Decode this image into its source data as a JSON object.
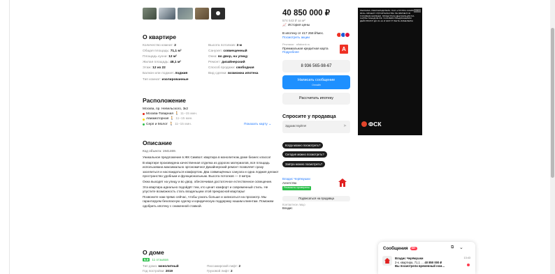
{
  "about": {
    "title": "О квартире",
    "left": [
      {
        "k": "Количество комнат:",
        "v": "2"
      },
      {
        "k": "Общая площадь:",
        "v": "71,1 м²"
      },
      {
        "k": "Площадь кухни:",
        "v": "12 м²"
      },
      {
        "k": "Жилая площадь:",
        "v": "48,1 м²"
      },
      {
        "k": "Этаж:",
        "v": "12 из 22"
      },
      {
        "k": "Балкон или лоджия:",
        "v": "лоджия"
      },
      {
        "k": "Тип комнат:",
        "v": "изолированные"
      }
    ],
    "right": [
      {
        "k": "Высота потолков:",
        "v": "3 м"
      },
      {
        "k": "Санузел:",
        "v": "совмещенный"
      },
      {
        "k": "Окна:",
        "v": "во двор, на улицу"
      },
      {
        "k": "Ремонт:",
        "v": "дизайнерский"
      },
      {
        "k": "Способ продажи:",
        "v": "свободная"
      },
      {
        "k": "Вид сделки:",
        "v": "возможна ипотека"
      }
    ]
  },
  "location": {
    "title": "Расположение",
    "address": "Москва, пр. Невельского, 3к2",
    "metro": [
      {
        "name": "Москва-Товарная",
        "time": "11–15 мин.",
        "color": "#e42313"
      },
      {
        "name": "Авиамоторная",
        "time": "11–15 мин.",
        "color": "#ffd702"
      },
      {
        "name": "Серп и Молот",
        "time": "11–15 мин.",
        "color": "#2bbf4a"
      }
    ],
    "show_map": "Показать карту"
  },
  "description": {
    "title": "Описание",
    "code": "Код объекта: 1941469.",
    "paragraphs": [
      "Уникальное предложение в ЖК Символ: квартира в монолитном доме бизнес класса!",
      "В квартире произведена качественная отделка из дорогих материалов, вся площадь использована максимально эргономично! Дизайнерский ремонт позволяет сразу заселиться и наслаждаться комфортом. Два совмещённых санузла и одна лоджия делают пространство удобным и функциональным. Высота потолков — 3 метра",
      "Окна выходят на улицу и во двор, обеспечивая достаточное естественное освещение.",
      "Эта квартира идеально подойдёт тем, кто ценит комфорт и современный стиль. Не упустите возможность стать владельцем этой прекрасной квартиры!",
      "Позвоните нам прямо сейчас, чтобы узнать больше и записаться на просмотр. Мы гарантируем безопасную сделку и юридическую поддержку нашим клиентам. Поможем одобрить ипотеку с сниженной ставкой."
    ]
  },
  "house": {
    "title": "О доме",
    "score": "5.0",
    "reviews": "11 отзывов",
    "params": [
      {
        "k": "Тип дома:",
        "v": "монолитный"
      },
      {
        "k": "Пассажирский лифт:",
        "v": "2"
      },
      {
        "k": "Год постройки:",
        "v": "2019"
      },
      {
        "k": "Грузовой лифт:",
        "v": "2"
      }
    ]
  },
  "sidebar": {
    "price": "40 850 000 ₽",
    "price_per_m": "574 543 ₽ за м²",
    "history": "История цены",
    "ipoteka_text": "В ипотеку от 417 258 ₽/мес.",
    "ipoteka_link": "Посмотреть акции",
    "card_tag": "Реклама · alfabank.ru",
    "card_text": "Премиальная кредитная карта",
    "card_more": "Подробнее",
    "phone": "8 936 565-98-67",
    "msg_button": "Написать сообщение",
    "msg_sub": "Онлайн",
    "calc_button": "Рассчитать ипотеку",
    "ask_title": "Спросите у продавца",
    "ask_placeholder": "Здравствуйте!",
    "quick_questions": [
      "Когда можно посмотреть?",
      "Сегодня можно посмотреть?",
      "Завтра можно посмотреть?"
    ],
    "seller_name": "Владис Черёмушки",
    "seller_type": "Агентство",
    "seller_badge": "Реквизиты проверены",
    "subscribe": "Подписаться на продавца",
    "contact_label": "Контактное лицо",
    "contact_value": "Владис"
  },
  "ad": {
    "legal": "РЕКЛАМА. РЕКЛАМОДАТЕЛЬ: ПАО «ГРУППА КОМПАНИЙ ФСК» ОБЪЕКТ СТРОИТЕЛЬСТВА НЕ ЯВЛЯЕТСЯ ГОТОВЫМ ЖИЛЬЁМ. ПРОЕКТНАЯ ДЕКЛАРАЦИЯ НА САЙТЕ НАШ.ДОМ.РФ. УСЛОВИЯ ПРЕДЛОЖЕНИЯ ДЕЙСТВУЮТ ДО 31.12 И МОГУТ БЫТЬ ИЗМЕНЕНЫ",
    "close": "×",
    "brand": "ФСК"
  },
  "chat": {
    "title": "Сообщения",
    "count": "99+",
    "contact": "Владис Черёмушки",
    "topic": "2-к. квартира, 71,1 …",
    "topic_price": "40 850 000 ₽",
    "last": "Вы посмотрели временный ном…",
    "time": "13:43"
  }
}
